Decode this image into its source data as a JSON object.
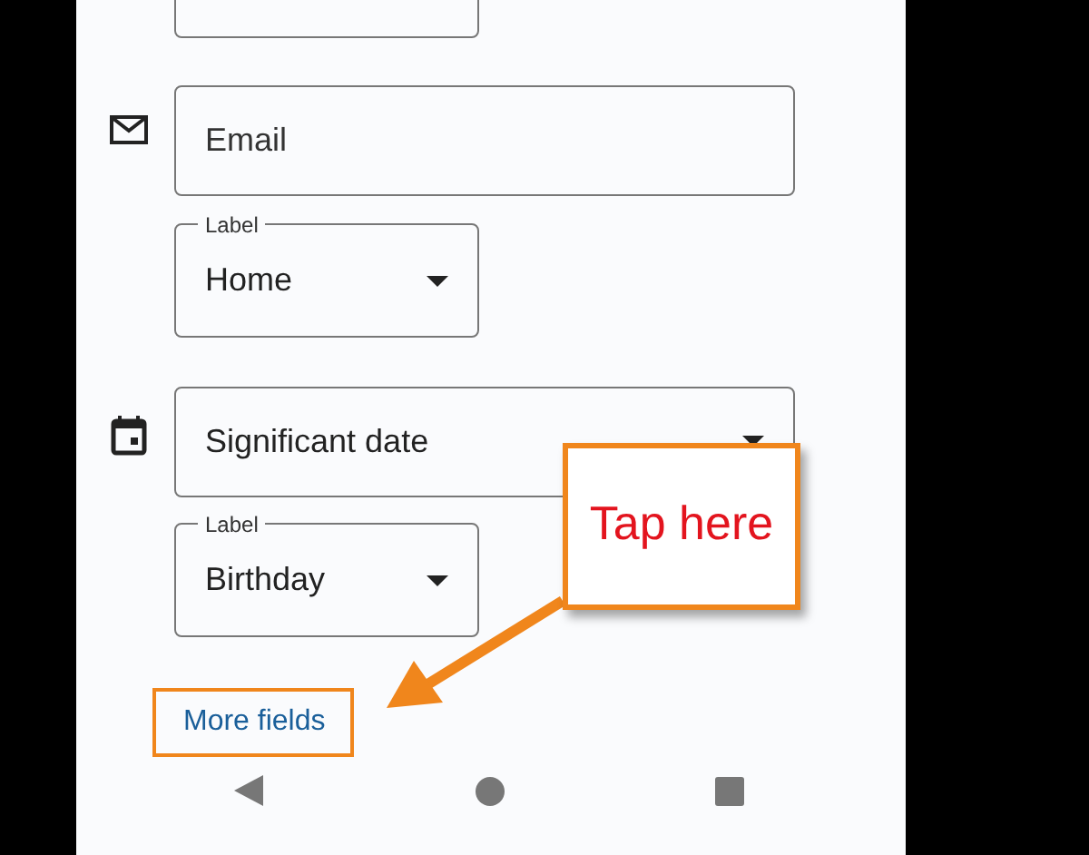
{
  "fields": [
    {
      "kind": "email",
      "placeholder": "Email"
    },
    {
      "kind": "label-select",
      "floating_label": "Label",
      "value": "Home"
    },
    {
      "kind": "date-select",
      "value": "Significant date"
    },
    {
      "kind": "label-select",
      "floating_label": "Label",
      "value": "Birthday"
    }
  ],
  "more_fields_link": "More fields",
  "callout": {
    "text": "Tap here"
  }
}
